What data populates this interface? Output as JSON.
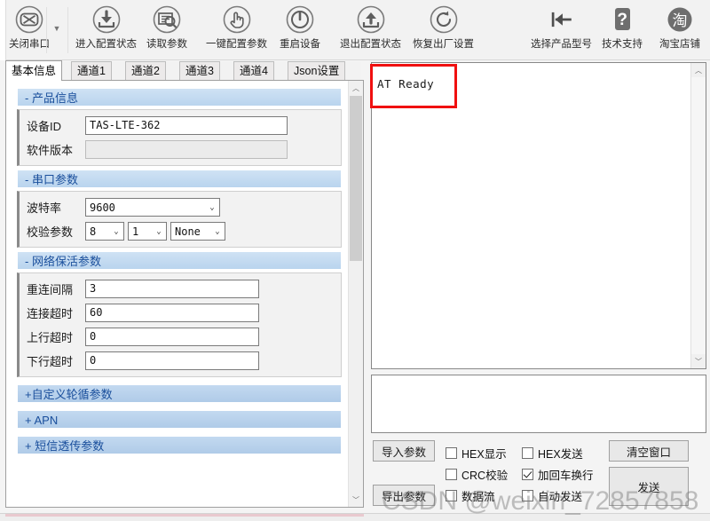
{
  "toolbar": {
    "items": [
      {
        "label": "关闭串口",
        "icon": "close-serial-icon",
        "has_caret": true
      },
      {
        "label": "进入配置状态",
        "icon": "download-config-icon",
        "has_caret": false
      },
      {
        "label": "读取参数",
        "icon": "read-params-icon",
        "has_caret": false
      },
      {
        "label": "一键配置参数",
        "icon": "one-key-config-icon",
        "has_caret": false
      },
      {
        "label": "重启设备",
        "icon": "power-restart-icon",
        "has_caret": false
      },
      {
        "label": "退出配置状态",
        "icon": "upload-exit-icon",
        "has_caret": false
      },
      {
        "label": "恢复出厂设置",
        "icon": "refresh-factory-reset-icon",
        "has_caret": false
      },
      {
        "label": "选择产品型号",
        "icon": "select-model-arrow-icon",
        "has_caret": false
      },
      {
        "label": "技术支持",
        "icon": "question-help-icon",
        "has_caret": false
      },
      {
        "label": "淘宝店铺",
        "icon": "taobao-shop-icon",
        "has_caret": false
      }
    ]
  },
  "tabs": [
    {
      "label": "基本信息",
      "active": true
    },
    {
      "label": "通道1",
      "active": false
    },
    {
      "label": "通道2",
      "active": false
    },
    {
      "label": "通道3",
      "active": false
    },
    {
      "label": "通道4",
      "active": false
    },
    {
      "label": "Json设置",
      "active": false
    }
  ],
  "sections": {
    "product": {
      "title": "- 产品信息",
      "fields": [
        {
          "label": "设备ID",
          "value": "TAS-LTE-362",
          "disabled": false
        },
        {
          "label": "软件版本",
          "value": "",
          "disabled": true
        }
      ]
    },
    "serial": {
      "title": "- 串口参数",
      "baud": {
        "label": "波特率",
        "value": "9600"
      },
      "parity": {
        "label": "校验参数",
        "databits": "8",
        "stopbits": "1",
        "parity": "None"
      }
    },
    "keepalive": {
      "title": "- 网络保活参数",
      "fields": [
        {
          "label": "重连间隔",
          "value": "3"
        },
        {
          "label": "连接超时",
          "value": "60"
        },
        {
          "label": "上行超时",
          "value": "0"
        },
        {
          "label": "下行超时",
          "value": "0"
        }
      ]
    },
    "collapsed": [
      {
        "title": "+自定义轮循参数"
      },
      {
        "title": "+ APN"
      },
      {
        "title": "+ 短信透传参数"
      }
    ]
  },
  "log": {
    "content": "AT Ready"
  },
  "send": {
    "value": ""
  },
  "controls": {
    "buttons": [
      {
        "name": "import-params",
        "label": "导入参数"
      },
      {
        "name": "export-params",
        "label": "导出参数"
      },
      {
        "name": "clear-window",
        "label": "清空窗口"
      },
      {
        "name": "send",
        "label": "发送"
      }
    ],
    "checkboxes": [
      {
        "name": "hex-display",
        "label": "HEX显示",
        "checked": false
      },
      {
        "name": "hex-send",
        "label": "HEX发送",
        "checked": false
      },
      {
        "name": "crc-check",
        "label": "CRC校验",
        "checked": false
      },
      {
        "name": "append-crlf",
        "label": "加回车换行",
        "checked": true
      },
      {
        "name": "data-stream",
        "label": "数据流",
        "checked": false
      },
      {
        "name": "auto-send",
        "label": "自动发送",
        "checked": false
      }
    ]
  },
  "watermark": {
    "text": "CSDN @weixin_72857858"
  },
  "colors": {
    "section_header_text": "#1a4f9c",
    "section_header_bg": "#c3d9f0",
    "annotation": "#f01010",
    "toolbar_bg": "#f2f2f2"
  }
}
